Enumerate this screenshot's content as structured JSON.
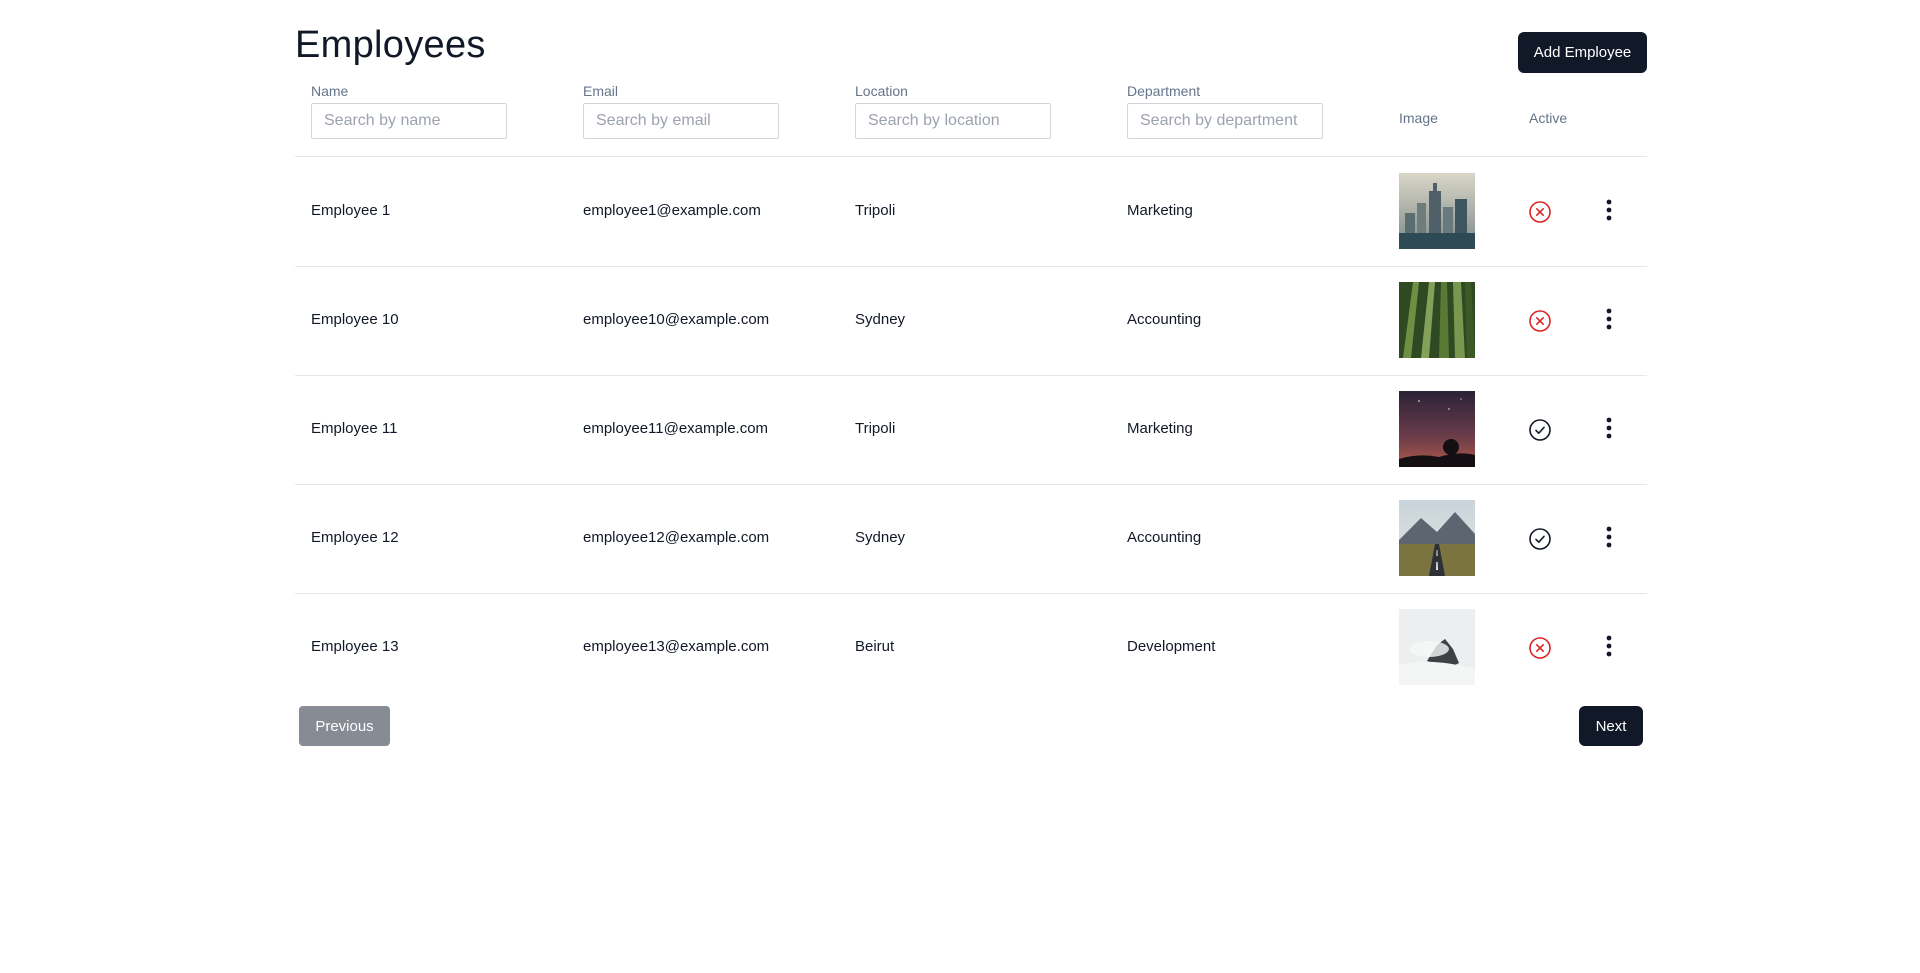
{
  "page": {
    "title": "Employees",
    "add_button": "Add Employee"
  },
  "columns": {
    "name": {
      "label": "Name",
      "placeholder": "Search by name"
    },
    "email": {
      "label": "Email",
      "placeholder": "Search by email"
    },
    "location": {
      "label": "Location",
      "placeholder": "Search by location"
    },
    "department": {
      "label": "Department",
      "placeholder": "Search by department"
    },
    "image": "Image",
    "active": "Active"
  },
  "rows": [
    {
      "name": "Employee 1",
      "email": "employee1@example.com",
      "location": "Tripoli",
      "department": "Marketing",
      "active": false,
      "image": "city-skyline"
    },
    {
      "name": "Employee 10",
      "email": "employee10@example.com",
      "location": "Sydney",
      "department": "Accounting",
      "active": false,
      "image": "bamboo-forest"
    },
    {
      "name": "Employee 11",
      "email": "employee11@example.com",
      "location": "Tripoli",
      "department": "Marketing",
      "active": true,
      "image": "dusk-sky"
    },
    {
      "name": "Employee 12",
      "email": "employee12@example.com",
      "location": "Sydney",
      "department": "Accounting",
      "active": true,
      "image": "mountain-road"
    },
    {
      "name": "Employee 13",
      "email": "employee13@example.com",
      "location": "Beirut",
      "department": "Development",
      "active": false,
      "image": "misty-peak"
    }
  ],
  "pagination": {
    "previous": "Previous",
    "next": "Next"
  },
  "colors": {
    "primary": "#111827",
    "inactive": "#dc2626",
    "active": "#111827",
    "muted_button": "#868b94",
    "header_text": "#64748b",
    "divider": "#e5e7eb"
  },
  "icons": {
    "inactive": "x-circle-icon",
    "active": "check-circle-icon",
    "row_menu": "more-vertical-icon"
  }
}
